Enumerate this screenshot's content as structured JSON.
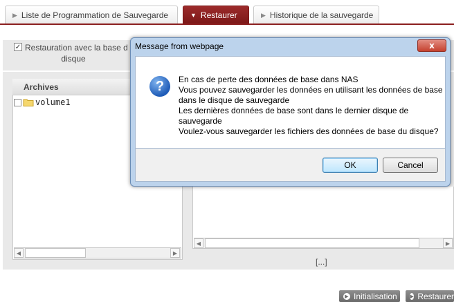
{
  "tabs": [
    {
      "label": "Liste de Programmation de Sauvegarde",
      "active": false
    },
    {
      "label": "Restaurer",
      "active": true
    },
    {
      "label": "Historique de la sauvegarde",
      "active": false
    }
  ],
  "restore_option": {
    "label_line1": "Restauration avec la base d",
    "label_line2": "disque",
    "checked": true
  },
  "archives": {
    "header": "Archives",
    "items": [
      {
        "label": "volume1"
      }
    ]
  },
  "pagination_text": "[...]",
  "actions": {
    "initialisation": "Initialisation",
    "restaurer": "Restaurer"
  },
  "dialog": {
    "title": "Message from webpage",
    "close_glyph": "x",
    "icon": "question-icon",
    "lines": [
      "En cas de perte des données de base dans NAS",
      "Vous pouvez sauvegarder les données en utilisant les données de base",
      "dans le disque de sauvegarde",
      "Les dernières données de base sont dans le dernier disque de",
      "sauvegarde",
      "Voulez-vous sauvegarder les fichiers des données de base du disque?"
    ],
    "ok": "OK",
    "cancel": "Cancel"
  }
}
